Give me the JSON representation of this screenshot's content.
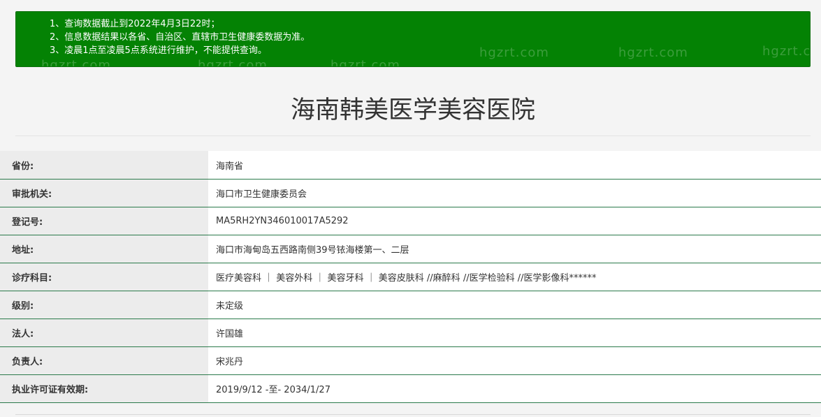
{
  "notice": {
    "items": [
      "1、查询数据截止到2022年4月3日22时；",
      "2、信息数据结果以各省、自治区、直辖市卫生健康委数据为准。",
      "3、凌晨1点至凌晨5点系统进行维护，不能提供查询。"
    ],
    "background_color": "#048204"
  },
  "watermark": "hgzrt.com",
  "page_title": "海南韩美医学美容医院",
  "details": [
    {
      "label": "省份:",
      "value": "海南省"
    },
    {
      "label": "审批机关:",
      "value": "海口市卫生健康委员会"
    },
    {
      "label": "登记号:",
      "value": "MA5RH2YN346010017A5292"
    },
    {
      "label": "地址:",
      "value": "海口市海甸岛五西路南侧39号铱海楼第一、二层"
    },
    {
      "label": "诊疗科目:",
      "value": "医疗美容科 ｜ 美容外科 ｜ 美容牙科 ｜ 美容皮肤科 //麻醉科 //医学检验科 //医学影像科******"
    },
    {
      "label": "级别:",
      "value": "未定级"
    },
    {
      "label": "法人:",
      "value": "许国雄"
    },
    {
      "label": "负责人:",
      "value": "宋兆丹"
    },
    {
      "label": "执业许可证有效期:",
      "value": "2019/9/12 -至- 2034/1/27"
    }
  ]
}
